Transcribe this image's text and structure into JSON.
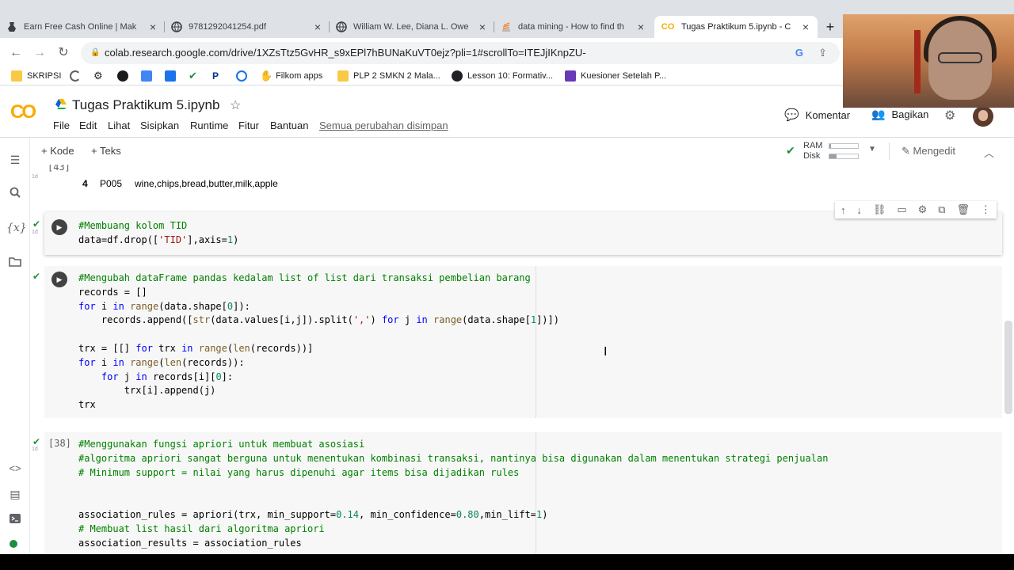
{
  "browser": {
    "tabs": [
      {
        "title": "Earn Free Cash Online | Mak",
        "icon": "vase-icon"
      },
      {
        "title": "9781292041254.pdf",
        "icon": "globe-icon"
      },
      {
        "title": "William W. Lee, Diana L. Owe",
        "icon": "globe-icon"
      },
      {
        "title": "data mining - How to find th",
        "icon": "stack-icon"
      },
      {
        "title": "Tugas Praktikum 5.ipynb - C",
        "icon": "colab-icon",
        "active": true
      }
    ],
    "url": "colab.research.google.com/drive/1XZsTtz5GvHR_s9xEPl7hBUNaKuVT0ejz?pli=1#scrollTo=ITEJjIKnpZU-",
    "bookmarks": [
      {
        "label": "SKRIPSI"
      },
      {
        "label": "Filkom apps"
      },
      {
        "label": "PLP 2 SMKN 2 Mala..."
      },
      {
        "label": "Lesson 10: Formativ..."
      },
      {
        "label": "Kuesioner Setelah P..."
      }
    ]
  },
  "colab": {
    "logo": "CO",
    "title": "Tugas Praktikum 5.ipynb",
    "menu": [
      "File",
      "Edit",
      "Lihat",
      "Sisipkan",
      "Runtime",
      "Fitur",
      "Bantuan"
    ],
    "saved_status": "Semua perubahan disimpan",
    "comment_label": "Komentar",
    "share_label": "Bagikan",
    "add_code": "+ Kode",
    "add_text": "+ Teks",
    "ram_label": "RAM",
    "disk_label": "Disk",
    "ram_usage": 0.05,
    "disk_usage": 0.25,
    "edit_label": "Mengedit"
  },
  "cells": {
    "prev_exec": "[43]",
    "output_row_index": "4",
    "output_row_tid": "P005",
    "output_row_items": "wine,chips,bread,butter,milk,apple",
    "exec_38": "[38]",
    "exec_time_a": "1d",
    "exec_time_b": "1d",
    "exec_time_c": "1d",
    "exec_time_d": "1d"
  }
}
